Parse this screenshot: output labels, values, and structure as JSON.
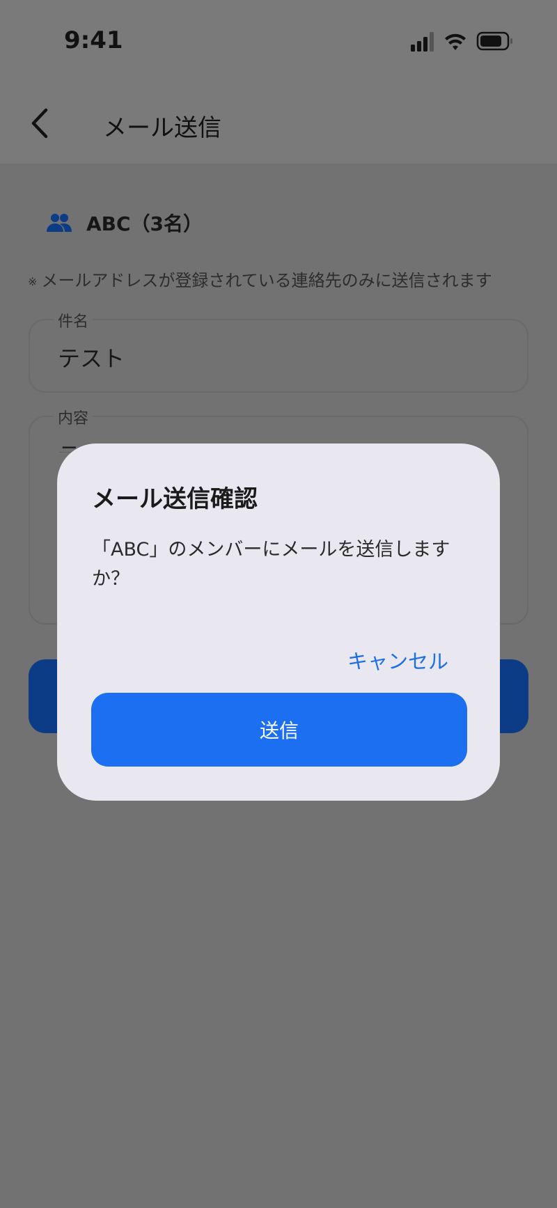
{
  "status_bar": {
    "time": "9:41"
  },
  "nav": {
    "title": "メール送信",
    "back_icon": "chevron-left-icon"
  },
  "group": {
    "icon": "group-icon",
    "label": "ABC（3名）"
  },
  "notice": {
    "mark": "※",
    "text": "メールアドレスが登録されている連絡先のみに送信されます"
  },
  "form": {
    "subject": {
      "label": "件名",
      "value": "テスト"
    },
    "body": {
      "label": "内容",
      "value": "テ"
    }
  },
  "dialog": {
    "title": "メール送信確認",
    "message": "「ABC」のメンバーにメールを送信しますか？",
    "cancel_label": "キャンセル",
    "send_label": "送信"
  },
  "colors": {
    "accent": "#1b6ff0",
    "link": "#1c6fe8",
    "overlay": "#777777",
    "dialog_bg": "#e9e8f0"
  }
}
